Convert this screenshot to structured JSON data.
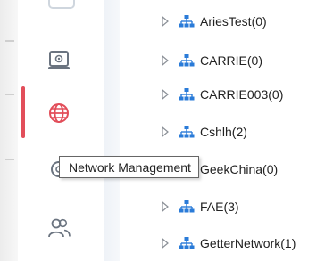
{
  "tooltip": {
    "text": "Network Management"
  },
  "rail": {
    "items": [
      {
        "icon": "partial-top-icon",
        "active": false
      },
      {
        "icon": "device-screen-icon",
        "active": false
      },
      {
        "icon": "globe-icon",
        "active": true
      },
      {
        "icon": "settings-icon",
        "active": false
      },
      {
        "icon": "users-icon",
        "active": false
      }
    ]
  },
  "tree": {
    "items": [
      {
        "label": "AriesTest(0)"
      },
      {
        "label": "CARRIE(0)"
      },
      {
        "label": "CARRIE003(0)"
      },
      {
        "label": "Cshlh(2)"
      },
      {
        "label": "GeekChina(0)"
      },
      {
        "label": "FAE(3)"
      },
      {
        "label": "GetterNetwork(1)"
      }
    ]
  },
  "colors": {
    "accent_active": "#e24e5a",
    "network_icon": "#2a7bd8",
    "rail_icon": "#6b7480"
  }
}
